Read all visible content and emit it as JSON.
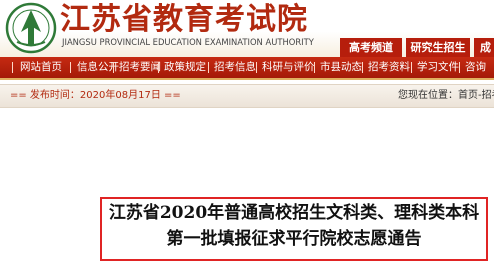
{
  "header": {
    "site_title": "江苏省教育考试院",
    "site_subtitle": "JIANGSU PROVINCIAL EDUCATION EXAMINATION AUTHORITY",
    "buttons": [
      {
        "label": "高考频道"
      },
      {
        "label": "研究生招生"
      },
      {
        "label": "成"
      }
    ]
  },
  "nav": {
    "items": [
      {
        "label": "网站首页"
      },
      {
        "label": "信息公开"
      },
      {
        "label": "招考要闻"
      },
      {
        "label": "政策规定"
      },
      {
        "label": "招考信息"
      },
      {
        "label": "科研与评价"
      },
      {
        "label": "市县动态"
      },
      {
        "label": "招考资料"
      },
      {
        "label": "学习文件"
      },
      {
        "label": "咨询"
      }
    ]
  },
  "infobar": {
    "publish_line": "== 发布时间：2020年08月17日 ==",
    "location": "您现在位置：首页-招考"
  },
  "article": {
    "title_line1": "江苏省2020年普通高校招生文科类、理科类本科",
    "title_line2": "第一批填报征求平行院校志愿通告"
  },
  "colors": {
    "brand_red": "#b22a10",
    "nav_red": "#b61e0c",
    "frame_red": "#e02424",
    "logo_green": "#2f7a38"
  }
}
